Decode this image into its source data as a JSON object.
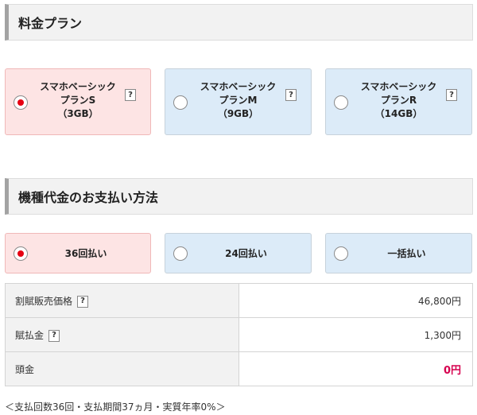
{
  "plan_section": {
    "title": "料金プラン",
    "options": [
      {
        "line1": "スマホベーシック",
        "line2": "プランS",
        "line3": "（3GB）",
        "help": "?",
        "selected": true
      },
      {
        "line1": "スマホベーシック",
        "line2": "プランM",
        "line3": "（9GB）",
        "help": "?",
        "selected": false
      },
      {
        "line1": "スマホベーシック",
        "line2": "プランR",
        "line3": "（14GB）",
        "help": "?",
        "selected": false
      }
    ]
  },
  "payment_section": {
    "title": "機種代金のお支払い方法",
    "options": [
      {
        "label": "36回払い",
        "selected": true
      },
      {
        "label": "24回払い",
        "selected": false
      },
      {
        "label": "一括払い",
        "selected": false
      }
    ]
  },
  "price_table": {
    "rows": [
      {
        "label": "割賦販売価格",
        "help": "?",
        "value": "46,800円"
      },
      {
        "label": "賦払金",
        "help": "?",
        "value": "1,300円"
      },
      {
        "label": "頭金",
        "value": "0円"
      }
    ]
  },
  "footnote": "＜支払回数36回・支払期間37ヵ月・実質年率0%＞",
  "colors": {
    "selected_bg": "#fde4e4",
    "unselected_bg": "#dcebf8",
    "radio_dot": "#e60012",
    "highlight_value": "#d6004e"
  }
}
